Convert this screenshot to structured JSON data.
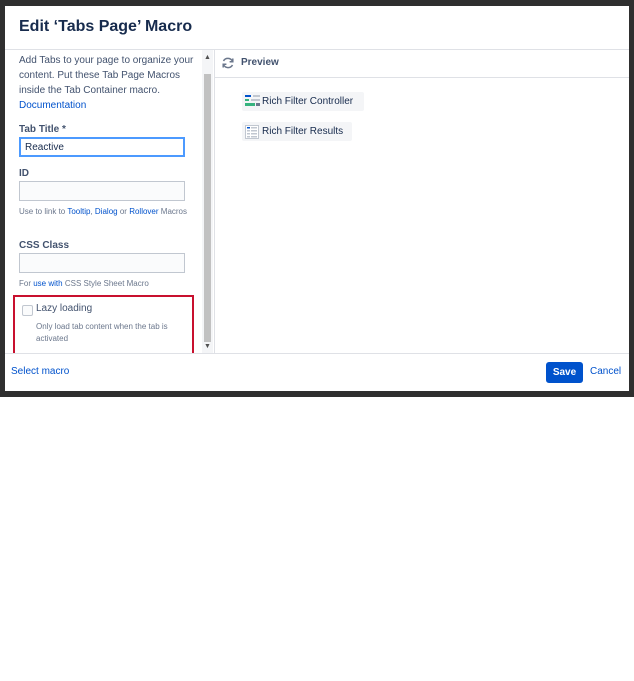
{
  "dialog": {
    "title": "Edit ‘Tabs Page’ Macro"
  },
  "left": {
    "description_text": "Add Tabs to your page to organize your content. Put these Tab Page Macros inside the Tab Container macro.",
    "documentation_link": "Documentation",
    "tab_title": {
      "label": "Tab Title *",
      "value": "Reactive"
    },
    "id": {
      "label": "ID",
      "value": "",
      "help_prefix": "Use to link to",
      "help_tooltip": "Tooltip",
      "help_comma": ",",
      "help_dialog": "Dialog",
      "help_or": "or",
      "help_rollover": "Rollover",
      "help_suffix": "Macros"
    },
    "css_class": {
      "label": "CSS Class",
      "value": "",
      "help_prefix": "For",
      "help_link": "use with",
      "help_suffix": "CSS Style Sheet Macro"
    },
    "lazy_loading": {
      "label": "Lazy loading",
      "checked": false,
      "help": "Only load tab content when the tab is activated"
    }
  },
  "preview": {
    "label": "Preview",
    "items": [
      {
        "label": "Rich Filter Controller",
        "icon": "filter-controller-icon"
      },
      {
        "label": "Rich Filter Results",
        "icon": "filter-results-icon"
      }
    ]
  },
  "footer": {
    "select_macro": "Select macro",
    "save": "Save",
    "cancel": "Cancel"
  },
  "colors": {
    "primary": "#0052cc",
    "highlight_border": "#c8102e",
    "focus_border": "#4c9aff"
  }
}
